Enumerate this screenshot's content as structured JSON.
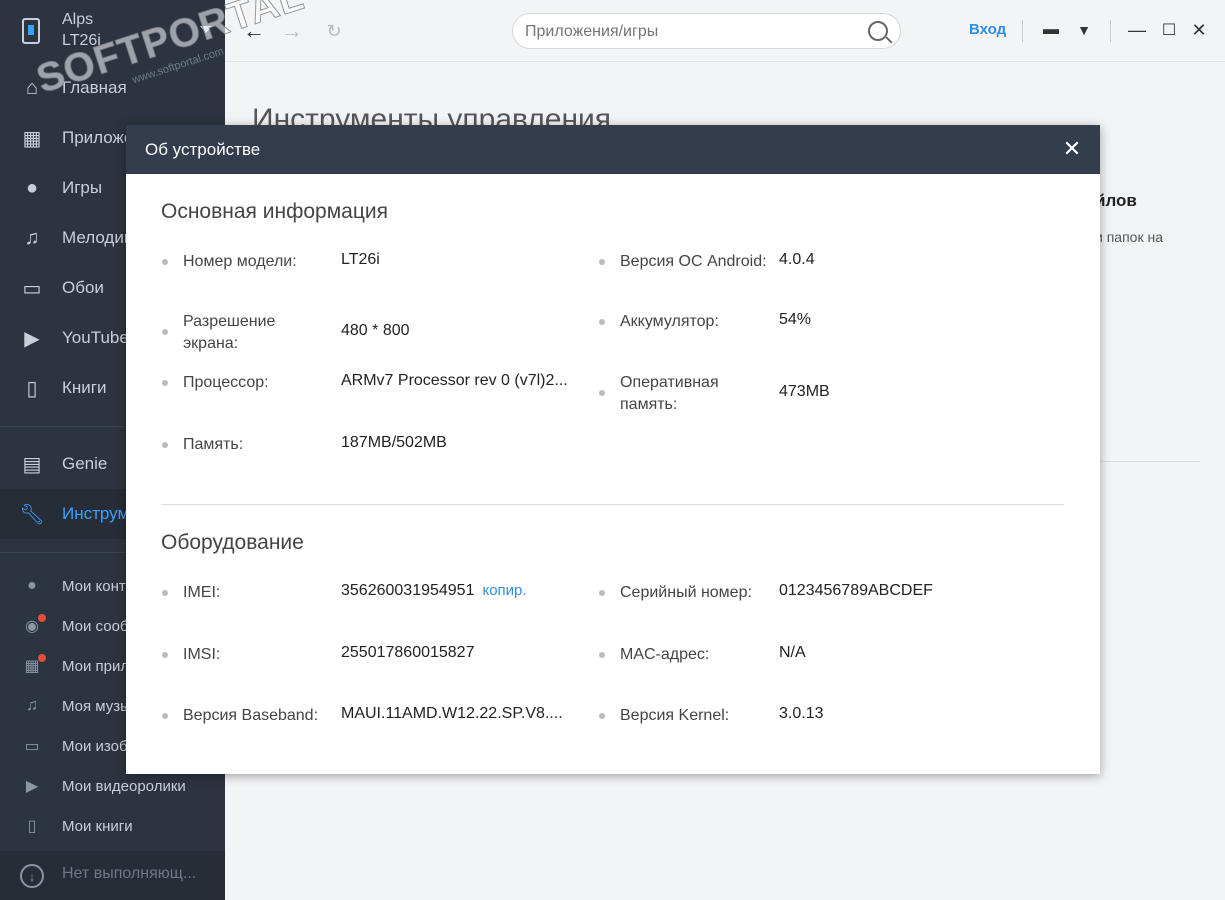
{
  "device": {
    "name": "Alps",
    "model": "LT26i"
  },
  "sidebar": {
    "main_items": [
      {
        "label": "Главная",
        "icon": "home-icon"
      },
      {
        "label": "Приложения",
        "icon": "apps-icon"
      },
      {
        "label": "Игры",
        "icon": "gamepad-icon"
      },
      {
        "label": "Мелодии",
        "icon": "music-icon"
      },
      {
        "label": "Обои",
        "icon": "wallpaper-icon"
      },
      {
        "label": "YouTube",
        "icon": "youtube-icon"
      },
      {
        "label": "Книги",
        "icon": "book-icon"
      }
    ],
    "tool_items": [
      {
        "label": "Genie",
        "icon": "genie-icon"
      },
      {
        "label": "Инструменты",
        "icon": "wrench-icon",
        "active": true
      }
    ],
    "my_items": [
      {
        "label": "Мои контакты",
        "icon": "contacts-icon"
      },
      {
        "label": "Мои сообщения",
        "icon": "messages-icon"
      },
      {
        "label": "Мои приложения",
        "icon": "my-apps-icon"
      },
      {
        "label": "Моя музыка",
        "icon": "my-music-icon"
      },
      {
        "label": "Мои изображения",
        "icon": "my-images-icon"
      },
      {
        "label": "Мои видеоролики",
        "icon": "my-videos-icon"
      },
      {
        "label": "Мои книги",
        "icon": "my-books-icon"
      }
    ],
    "status": "Нет выполняющ..."
  },
  "topbar": {
    "search_placeholder": "Приложения/игры",
    "login": "Вход"
  },
  "main": {
    "title": "Инструменты управления",
    "card_title": "йлов",
    "card_desc": "и папок на"
  },
  "watermark": {
    "big": "SOFTPORTAL",
    "small": "www.softportal.com"
  },
  "modal": {
    "title": "Об устройстве",
    "basic": {
      "title": "Основная информация",
      "model_label": "Номер модели:",
      "model_value": "LT26i",
      "android_label": "Версия ОС Android:",
      "android_value": "4.0.4",
      "resolution_label_1": "Разрешение",
      "resolution_label_2": "экрана:",
      "resolution_value": "480 * 800",
      "battery_label": "Аккумулятор:",
      "battery_value": "54%",
      "cpu_label": "Процессор:",
      "cpu_value": "ARMv7 Processor rev 0 (v7l)2...",
      "ram_label_1": "Оперативная",
      "ram_label_2": "память:",
      "ram_value": "473MB",
      "storage_label": "Память:",
      "storage_value": "187MB/502MB"
    },
    "hardware": {
      "title": "Оборудование",
      "imei_label": "IMEI:",
      "imei_value": "356260031954951",
      "copy": "копир.",
      "serial_label": "Серийный номер:",
      "serial_value": "0123456789ABCDEF",
      "imsi_label": "IMSI:",
      "imsi_value": "255017860015827",
      "mac_label": "MAC-адрес:",
      "mac_value": "N/A",
      "baseband_label": "Версия Baseband:",
      "baseband_value": "MAUI.11AMD.W12.22.SP.V8....",
      "kernel_label": "Версия Kernel:",
      "kernel_value": "3.0.13"
    }
  }
}
